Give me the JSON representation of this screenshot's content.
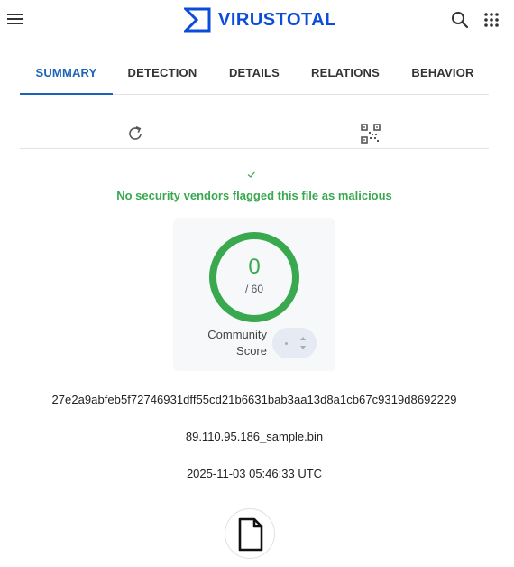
{
  "header": {
    "brand": "VIRUSTOTAL",
    "brand_color": "#0b4dda",
    "icons": [
      "menu-icon",
      "virustotal-logo",
      "search-icon",
      "apps-grid-icon"
    ]
  },
  "tabs": [
    {
      "label": "SUMMARY",
      "active": true
    },
    {
      "label": "DETECTION",
      "active": false
    },
    {
      "label": "DETAILS",
      "active": false
    },
    {
      "label": "RELATIONS",
      "active": false
    },
    {
      "label": "BEHAVIOR",
      "active": false
    }
  ],
  "toolbar": {
    "icons": [
      "reload-icon",
      "qr-code-icon"
    ]
  },
  "verdict": {
    "icon": "check-icon",
    "text": "No security vendors flagged this file as malicious",
    "color": "#3aa84f"
  },
  "score": {
    "detections": "0",
    "total": "/ 60",
    "community_label_line1": "Community",
    "community_label_line2": "Score",
    "ring_color": "#3aa84f"
  },
  "file": {
    "sha256": "27e2a9abfeb5f72746931dff55cd21b6631bab3aa13d8a1cb67c9319d8692229",
    "name": "89.110.95.186_sample.bin",
    "date": "2025-11-03 05:46:33 UTC",
    "icon": "file-icon"
  },
  "accent_color": "#1c62b9"
}
